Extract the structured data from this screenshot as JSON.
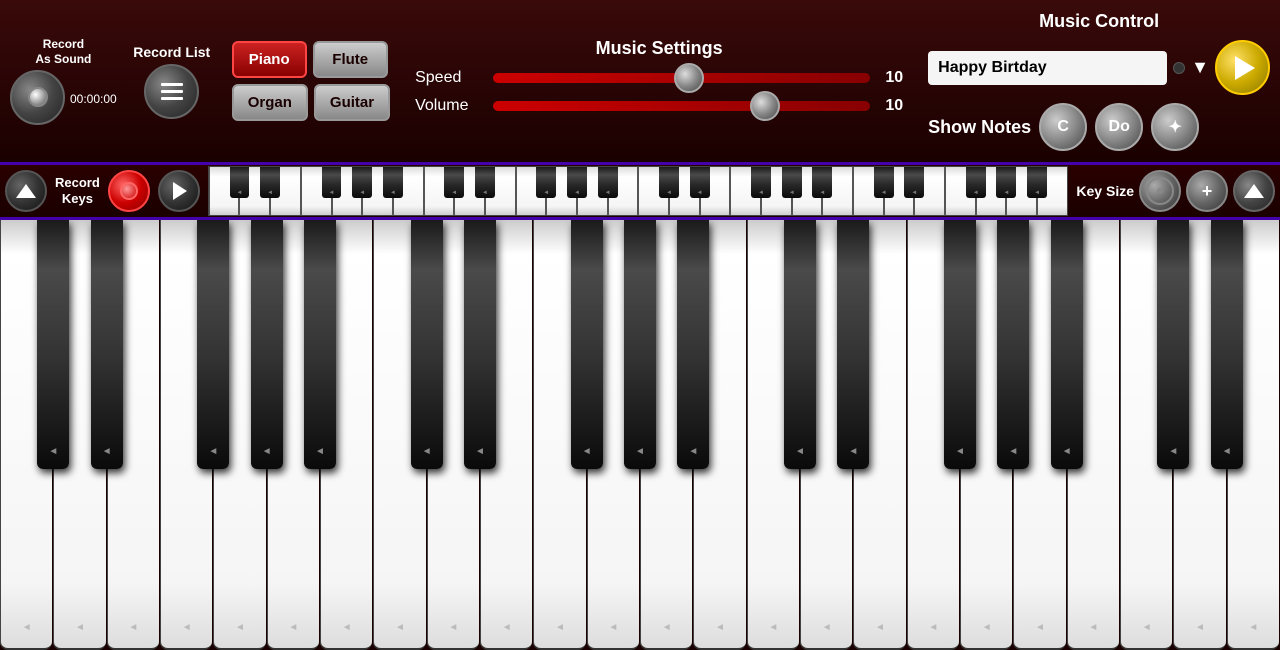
{
  "top_bar": {
    "record_as_sound": {
      "line1": "Record",
      "line2": "As Sound",
      "timer": "00:00:00"
    },
    "record_list": {
      "label": "Record List"
    },
    "instruments": [
      "Piano",
      "Flute",
      "Organ",
      "Guitar"
    ],
    "active_instrument": "Piano",
    "music_settings": {
      "title": "Music Settings",
      "speed_label": "Speed",
      "speed_value": "10",
      "volume_label": "Volume",
      "volume_value": "10"
    },
    "music_control": {
      "title": "Music Control",
      "song_name": "Happy Birtday",
      "show_notes_label": "Show Notes",
      "note_c": "C",
      "note_do": "Do"
    }
  },
  "keys_bar": {
    "record_keys_label": "Record\nKeys",
    "key_size_label": "Key Size"
  },
  "piano": {
    "octaves": 4,
    "white_keys_per_octave": 7
  }
}
